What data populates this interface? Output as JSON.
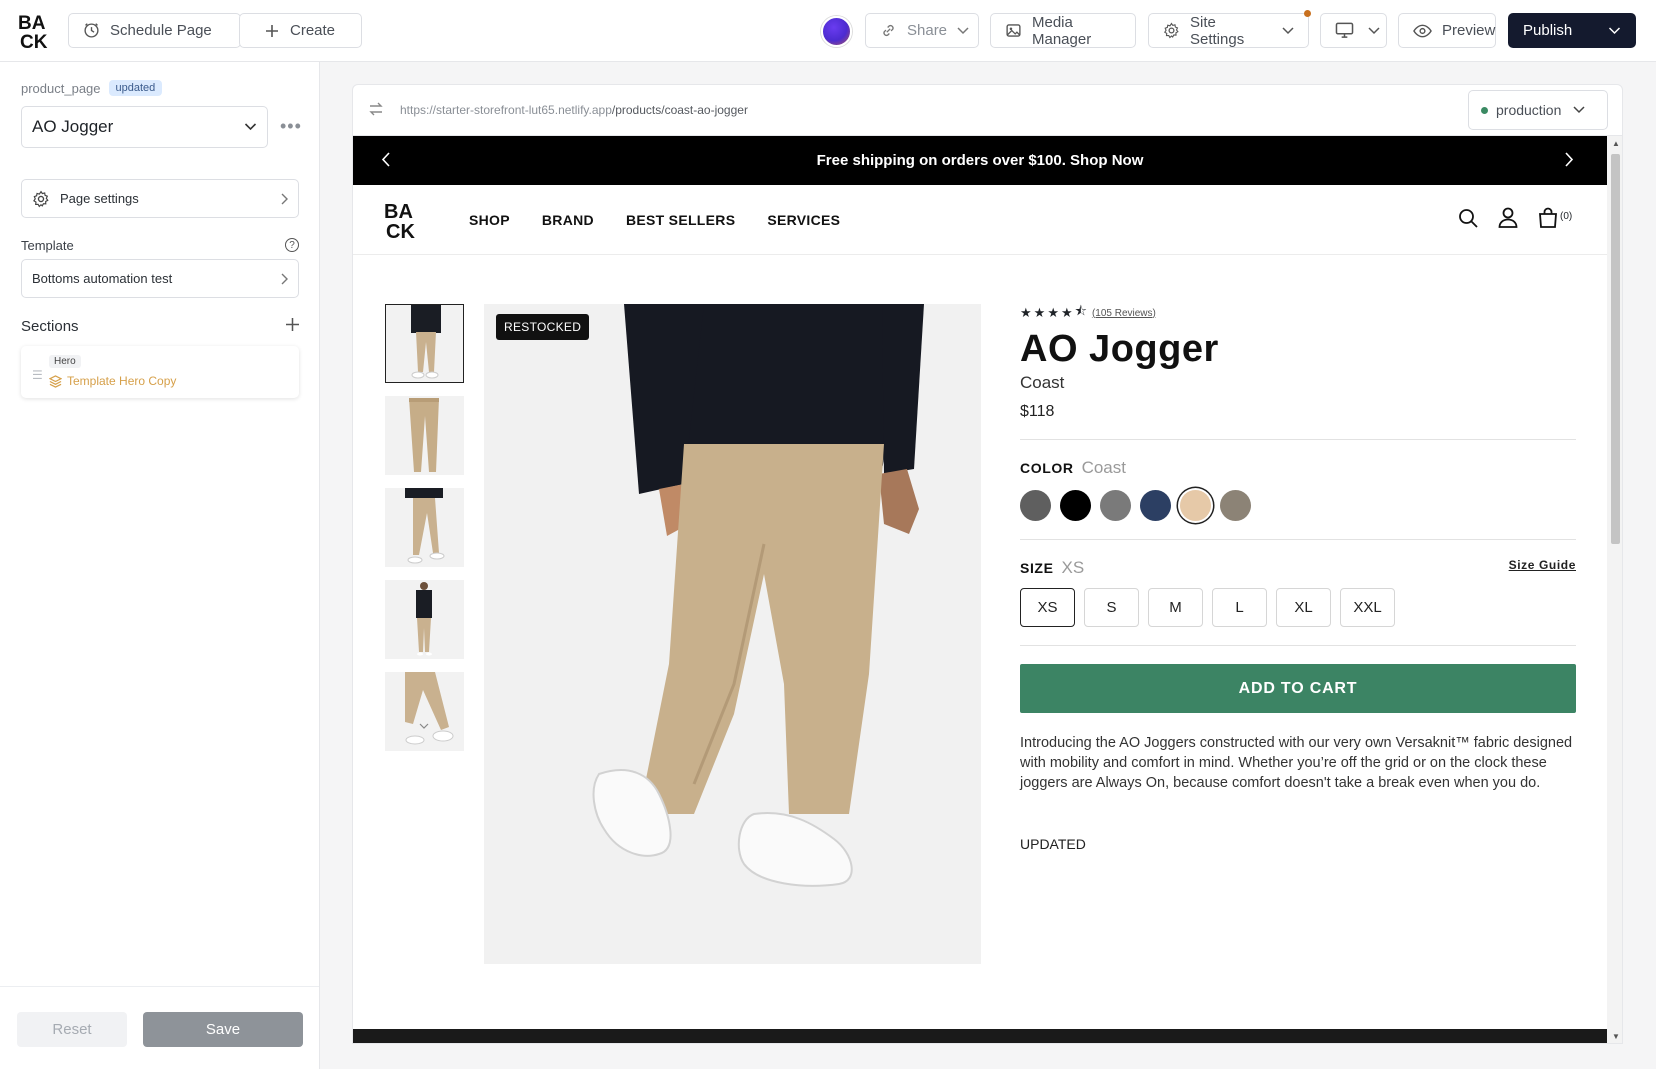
{
  "topbar": {
    "schedule_label": "Schedule Page",
    "create_label": "Create",
    "share_label": "Share",
    "media_label": "Media Manager",
    "site_settings_label": "Site Settings",
    "preview_label": "Preview",
    "publish_label": "Publish"
  },
  "sidebar": {
    "page_type": "product_page",
    "status_badge": "updated",
    "page_select": "AO Jogger",
    "page_settings_label": "Page settings",
    "template_label": "Template",
    "template_value": "Bottoms automation test",
    "sections_label": "Sections",
    "section_tag": "Hero",
    "section_name": "Template Hero Copy",
    "reset_label": "Reset",
    "save_label": "Save"
  },
  "preview": {
    "url_host": "https://starter-storefront-lut65.netlify.app",
    "url_path": "/products/coast-ao-jogger",
    "environment": "production"
  },
  "store": {
    "announcement": "Free shipping on orders over $100. Shop Now",
    "nav": [
      "SHOP",
      "BRAND",
      "BEST SELLERS",
      "SERVICES"
    ],
    "cart_count": "(0)"
  },
  "product": {
    "badge": "RESTOCKED",
    "rating": 4.5,
    "reviews": "(105 Reviews)",
    "title": "AO Jogger",
    "subtitle": "Coast",
    "price": "$118",
    "color_label": "COLOR",
    "color_value": "Coast",
    "swatches": [
      "#5f5f5f",
      "#000000",
      "#7a7a7a",
      "#2c3f63",
      "#e6c9a8",
      "#8c8376"
    ],
    "size_label": "SIZE",
    "size_value": "XS",
    "size_guide": "Size Guide",
    "sizes": [
      "XS",
      "S",
      "M",
      "L",
      "XL",
      "XXL"
    ],
    "add_to_cart": "ADD TO CART",
    "description": "Introducing the AO Joggers constructed with our very own Versaknit™ fabric designed with mobility and comfort in mind. Whether you’re off the grid or on the clock these joggers are Always On, because comfort doesn't take a break even when you do.",
    "extra_note": "UPDATED"
  },
  "colors": {
    "accent_green": "#3c8464",
    "publish_bg": "#141a2e"
  }
}
